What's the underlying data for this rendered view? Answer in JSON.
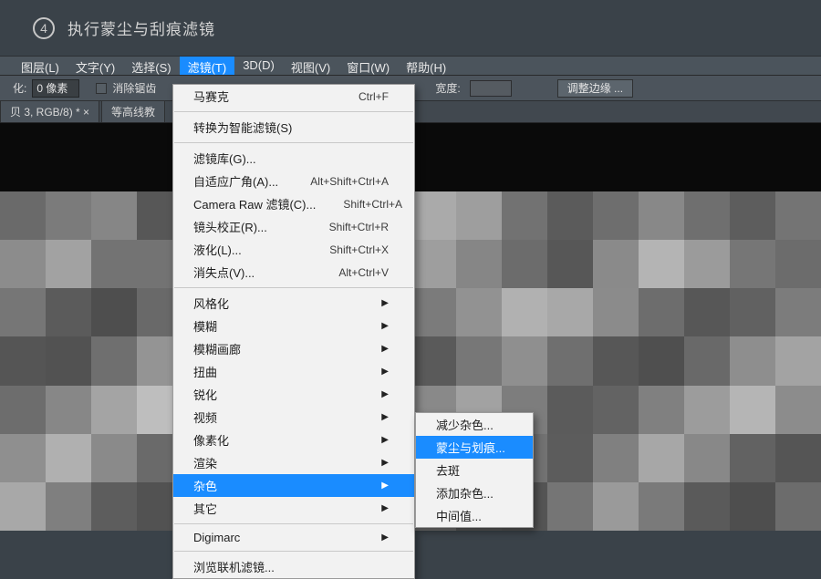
{
  "step": {
    "number": "4",
    "title": "执行蒙尘与刮痕滤镜"
  },
  "menubar": [
    {
      "label": "图层(L)",
      "active": false
    },
    {
      "label": "文字(Y)",
      "active": false
    },
    {
      "label": "选择(S)",
      "active": false
    },
    {
      "label": "滤镜(T)",
      "active": true
    },
    {
      "label": "3D(D)",
      "active": false
    },
    {
      "label": "视图(V)",
      "active": false
    },
    {
      "label": "窗口(W)",
      "active": false
    },
    {
      "label": "帮助(H)",
      "active": false
    }
  ],
  "optionsbar": {
    "feather_prefix": "化:",
    "feather_value": "0 像素",
    "antialias": "消除锯齿",
    "width_label": "宽度:",
    "refine_edge": "调整边缘 ..."
  },
  "doctabs": [
    {
      "label": "贝 3, RGB/8) *  ×"
    },
    {
      "label": "等高线教"
    }
  ],
  "filter_menu": {
    "top": {
      "label": "马赛克",
      "shortcut": "Ctrl+F"
    },
    "convert": "转换为智能滤镜(S)",
    "group1": [
      {
        "label": "滤镜库(G)...",
        "shortcut": ""
      },
      {
        "label": "自适应广角(A)...",
        "shortcut": "Alt+Shift+Ctrl+A"
      },
      {
        "label": "Camera Raw 滤镜(C)...",
        "shortcut": "Shift+Ctrl+A"
      },
      {
        "label": "镜头校正(R)...",
        "shortcut": "Shift+Ctrl+R"
      },
      {
        "label": "液化(L)...",
        "shortcut": "Shift+Ctrl+X"
      },
      {
        "label": "消失点(V)...",
        "shortcut": "Alt+Ctrl+V"
      }
    ],
    "group2": [
      {
        "label": "风格化"
      },
      {
        "label": "模糊"
      },
      {
        "label": "模糊画廊"
      },
      {
        "label": "扭曲"
      },
      {
        "label": "锐化"
      },
      {
        "label": "视频"
      },
      {
        "label": "像素化"
      },
      {
        "label": "渲染"
      },
      {
        "label": "杂色",
        "highlight": true
      },
      {
        "label": "其它"
      }
    ],
    "digimarc": "Digimarc",
    "browse": "浏览联机滤镜..."
  },
  "noise_submenu": [
    {
      "label": "减少杂色..."
    },
    {
      "label": "蒙尘与划痕...",
      "highlight": true
    },
    {
      "label": "去斑"
    },
    {
      "label": "添加杂色..."
    },
    {
      "label": "中间值..."
    }
  ],
  "mosaic_colors": [
    [
      "#6a6a6a",
      "#7b7b7b",
      "#868686",
      "#575757",
      "#5e5e5e",
      "#737373",
      "#848484",
      "#9c9c9c",
      "#b2b2b2",
      "#aaaaaa",
      "#9e9e9e",
      "#727272",
      "#5b5b5b",
      "#6e6e6e",
      "#888888",
      "#6f6f6f",
      "#5d5d5d",
      "#747474"
    ],
    [
      "#8c8c8c",
      "#a2a2a2",
      "#737373",
      "#737373",
      "#7d7d7d",
      "#555555",
      "#4d4d4d",
      "#6d6d6d",
      "#8b8b8b",
      "#9e9e9e",
      "#868686",
      "#6c6c6c",
      "#575757",
      "#8a8a8a",
      "#b4b4b4",
      "#9b9b9b",
      "#767676",
      "#6c6c6c"
    ],
    [
      "#767676",
      "#5b5b5b",
      "#4e4e4e",
      "#696969",
      "#888888",
      "#737373",
      "#5c5c5c",
      "#575757",
      "#656565",
      "#7b7b7b",
      "#929292",
      "#b1b1b1",
      "#a8a8a8",
      "#8b8b8b",
      "#6d6d6d",
      "#575757",
      "#616161",
      "#7c7c7c"
    ],
    [
      "#555555",
      "#525252",
      "#6f6f6f",
      "#949494",
      "#afafaf",
      "#9c9c9c",
      "#828282",
      "#6d6d6d",
      "#555555",
      "#5a5a5a",
      "#777777",
      "#8f8f8f",
      "#6f6f6f",
      "#575757",
      "#4f4f4f",
      "#696969",
      "#8e8e8e",
      "#a3a3a3"
    ],
    [
      "#6d6d6d",
      "#878787",
      "#a4a4a4",
      "#bebebe",
      "#989898",
      "#747474",
      "#606060",
      "#505050",
      "#676767",
      "#898989",
      "#a2a2a2",
      "#7d7d7d",
      "#5b5b5b",
      "#636363",
      "#808080",
      "#9c9c9c",
      "#b5b5b5",
      "#8c8c8c"
    ],
    [
      "#8f8f8f",
      "#b0b0b0",
      "#8a8a8a",
      "#6a6a6a",
      "#565656",
      "#525252",
      "#6b6b6b",
      "#8b8b8b",
      "#a8a8a8",
      "#bcbcbc",
      "#999999",
      "#727272",
      "#5c5c5c",
      "#808080",
      "#a7a7a7",
      "#888888",
      "#626262",
      "#555555"
    ],
    [
      "#a8a8a8",
      "#7f7f7f",
      "#5d5d5d",
      "#525252",
      "#676767",
      "#898989",
      "#a5a5a5",
      "#bfbfbf",
      "#9a9a9a",
      "#737373",
      "#5a5a5a",
      "#555555",
      "#757575",
      "#9a9a9a",
      "#7a7a7a",
      "#5a5a5a",
      "#4e4e4e",
      "#6c6c6c"
    ]
  ]
}
